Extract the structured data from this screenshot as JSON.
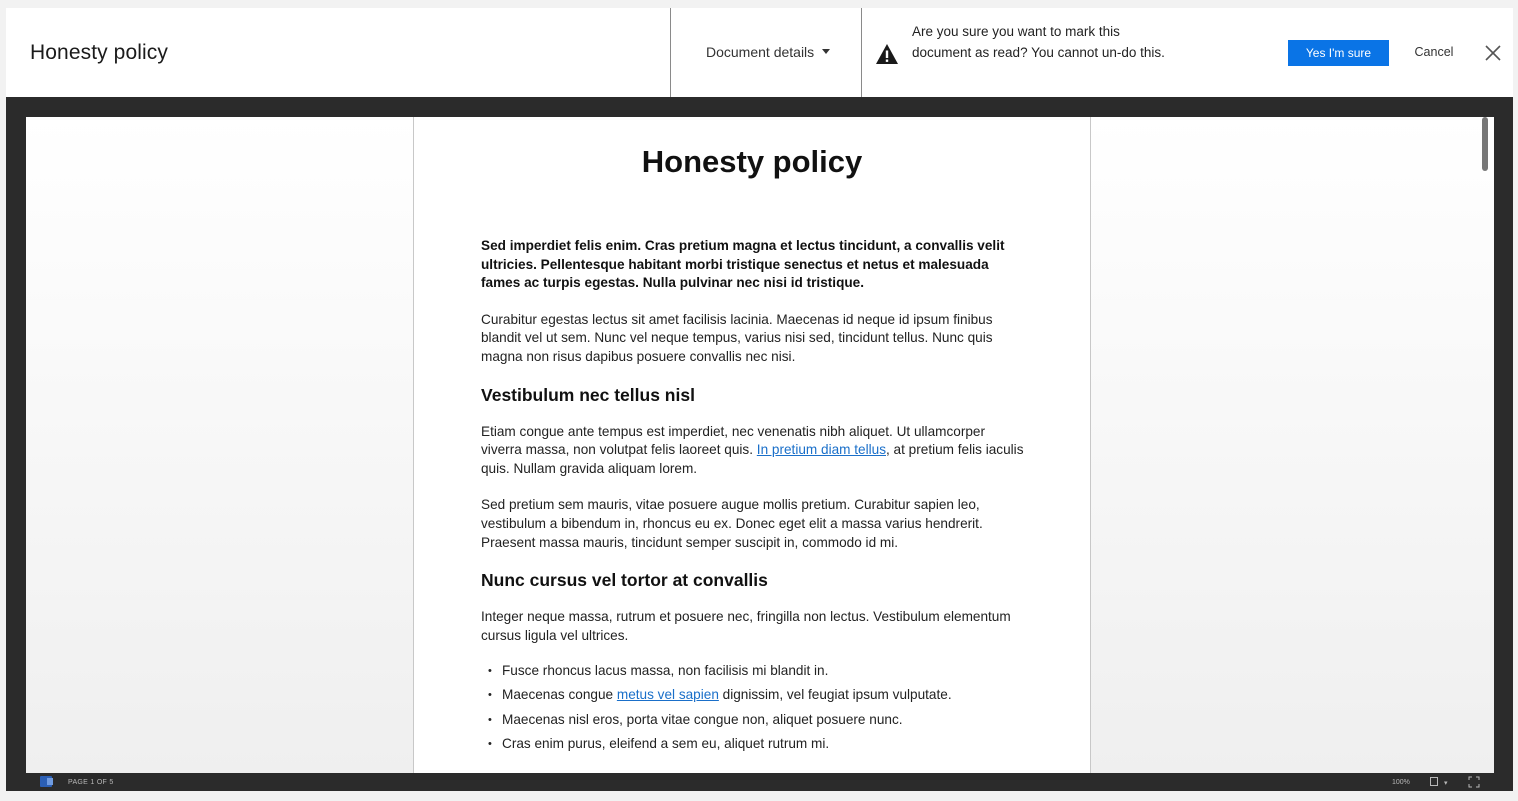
{
  "header": {
    "title": "Honesty policy",
    "details_label": "Document details",
    "confirm_message": "Are you sure you want to mark this document as read? You cannot un-do this.",
    "yes_label": "Yes I'm sure",
    "cancel_label": "Cancel"
  },
  "document": {
    "title": "Honesty policy",
    "intro_bold": "Sed imperdiet felis enim. Cras pretium magna et lectus tincidunt, a convallis velit ultricies. Pellentesque habitant morbi tristique senectus et netus et malesuada fames ac turpis egestas. Nulla pulvinar nec nisi id tristique.",
    "para1": "Curabitur egestas lectus sit amet facilisis lacinia. Maecenas id neque id ipsum finibus blandit vel ut sem. Nunc vel neque tempus, varius nisi sed, tincidunt tellus. Nunc quis magna non risus dapibus posuere convallis nec nisi.",
    "heading1": "Vestibulum nec tellus nisl",
    "para2_before": "Etiam congue ante tempus est imperdiet, nec venenatis nibh aliquet. Ut ullamcorper viverra massa, non volutpat felis laoreet quis. ",
    "para2_link": "In pretium diam tellus",
    "para2_after": ", at pretium felis iaculis quis. Nullam gravida aliquam lorem.",
    "para3": "Sed pretium sem mauris, vitae posuere augue mollis pretium. Curabitur sapien leo, vestibulum a bibendum in, rhoncus eu ex. Donec eget elit a massa varius hendrerit. Praesent massa mauris, tincidunt semper suscipit in, commodo id mi.",
    "heading2": "Nunc cursus vel tortor at convallis",
    "para4": "Integer neque massa, rutrum et posuere nec, fringilla non lectus. Vestibulum elementum cursus ligula vel ultrices.",
    "bullets": [
      {
        "text": "Fusce rhoncus lacus massa, non facilisis mi blandit in."
      },
      {
        "before": "Maecenas congue ",
        "link": "metus vel sapien",
        "after": " dignissim, vel feugiat ipsum vulputate."
      },
      {
        "text": "Maecenas nisl eros, porta vitae congue non, aliquet posuere nunc."
      },
      {
        "text": "Cras enim purus, eleifend a sem eu, aliquet rutrum mi."
      }
    ]
  },
  "status_bar": {
    "page_indicator": "PAGE 1 OF 5",
    "zoom": "100%"
  },
  "icons": {
    "warning": "warning-triangle-icon",
    "close": "close-icon",
    "word": "word-icon",
    "view": "view-mode-icon",
    "fullscreen": "fullscreen-icon"
  },
  "colors": {
    "accent": "#0a74e6",
    "link": "#1a6fc9",
    "viewer_frame": "#2b2b2b"
  }
}
